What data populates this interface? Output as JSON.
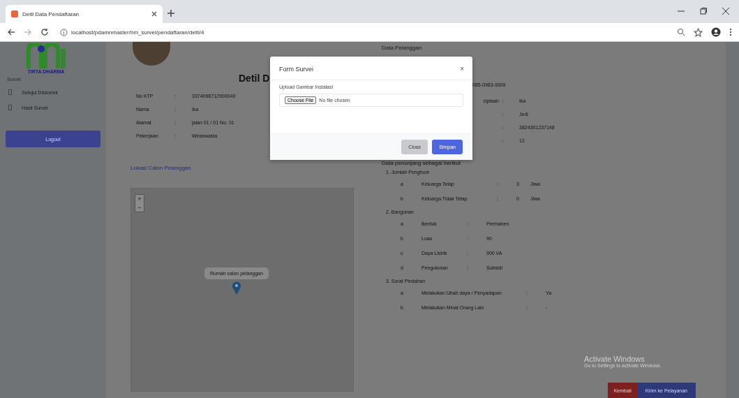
{
  "browser": {
    "tab_title": "Detil Data Pendaftaran",
    "url": "localhost/pdamnmaster/hm_survei/pendaftaran/detil/4"
  },
  "sidebar": {
    "logo_text": "TIRTA DHARMA",
    "heading": "Survei",
    "items": [
      {
        "label": "Setujui Diskonek",
        "selected": false
      },
      {
        "label": "Hasil Survei",
        "selected": false
      }
    ],
    "logout": "Logout"
  },
  "detail": {
    "title": "Detil D",
    "fields": [
      {
        "label": "No KTP",
        "sep": ":",
        "value": "3374098712900040"
      },
      {
        "label": "Nama",
        "sep": ":",
        "value": "Ika"
      },
      {
        "label": "Alamat",
        "sep": ":",
        "value": "jalan 01 / 01 No. 01"
      },
      {
        "label": "Pekerjaan",
        "sep": ":",
        "value": "Wiraswasta"
      }
    ],
    "map_link": "Lokasi Calon Pelanggan",
    "map": {
      "zoom_in": "+",
      "zoom_out": "−",
      "popup": "Rumah calon pelanggan"
    }
  },
  "customer": {
    "title": "Data Pelanggan",
    "phone": "085-0983-9309",
    "rows": [
      {
        "label": "ciptaan",
        "sep": ":",
        "value": "Ika"
      },
      {
        "sep": ":",
        "value": "Jedi"
      },
      {
        "sep": ":",
        "value": "3824301237148"
      },
      {
        "sep": ":",
        "value": "12"
      }
    ]
  },
  "support": {
    "title": "Data penunjang sebagai berikut",
    "sections": [
      {
        "heading": "1. Jumlah Penghuni",
        "kind": "count",
        "items": [
          {
            "letter": "a",
            "label": "Keluarga Tetap",
            "sep": ":",
            "value": "3",
            "unit": "Jiwa"
          },
          {
            "letter": "b",
            "label": "Keluarga Tidak Tetap",
            "sep": ":",
            "value": "0",
            "unit": "Jiwa"
          }
        ]
      },
      {
        "heading": "2. Bangunan",
        "kind": "plain",
        "items": [
          {
            "letter": "a",
            "label": "Bentuk",
            "sep": ":",
            "value": "Permanen"
          },
          {
            "letter": "b",
            "label": "Luas",
            "sep": ":",
            "value": "90"
          },
          {
            "letter": "c",
            "label": "Daya Listrik",
            "sep": ":",
            "value": "900 VA"
          },
          {
            "letter": "d",
            "label": "Pengukuran",
            "sep": ":",
            "value": "Subsidi"
          }
        ]
      },
      {
        "heading": "3. Surat Pindahan",
        "kind": "wide",
        "items": [
          {
            "letter": "a",
            "label": "Melakukan Ubah daya / Penyadapan",
            "sep": ":",
            "value": "Ya"
          },
          {
            "letter": "b",
            "label": "Melakukan Minat Orang Lain",
            "sep": ":",
            "value": "-"
          }
        ]
      }
    ]
  },
  "actions": {
    "back": "Kembali",
    "send": "Kirim ke Pelayanan"
  },
  "activation": {
    "title": "Activate Windows",
    "subtitle": "Go to Settings to activate Windows."
  },
  "modal": {
    "title": "Form Survei",
    "close_icon": "×",
    "field_label": "Upload Gambar Instalasi",
    "file_button": "Choose File",
    "file_status": "No file chosen",
    "buttons": [
      {
        "label": "Close",
        "kind": "secondary"
      },
      {
        "label": "Simpan",
        "kind": "primary"
      }
    ]
  }
}
